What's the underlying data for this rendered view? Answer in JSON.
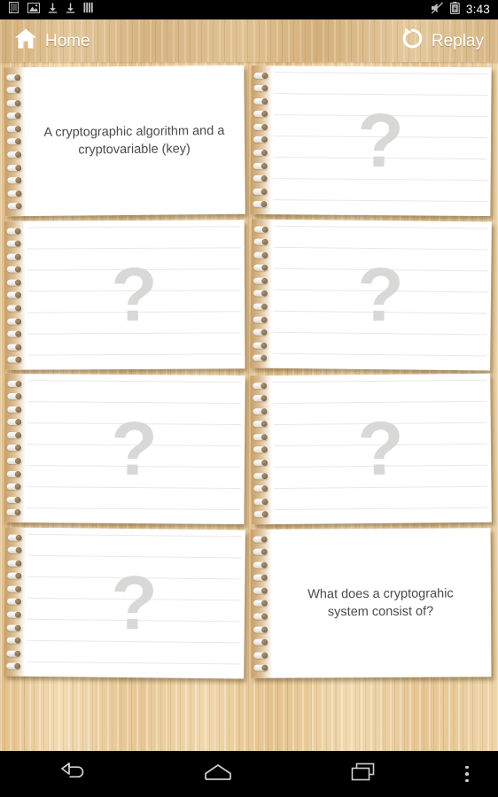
{
  "status_bar": {
    "icons": [
      "list-document-icon",
      "image-icon",
      "download-icon",
      "download-icon",
      "signal-bars-icon"
    ],
    "mute_icon": "volume-muted-icon",
    "battery_icon": "battery-charging-icon",
    "time": "3:43"
  },
  "header": {
    "home": {
      "icon": "home-icon",
      "label": "Home"
    },
    "replay": {
      "icon": "replay-icon",
      "label": "Replay"
    }
  },
  "board": {
    "columns": 2,
    "rows": 4,
    "face_down_symbol": "?",
    "cards": [
      {
        "position": 1,
        "state": "face-up",
        "text": "A cryptographic algorithm and a cryptovariable (key)"
      },
      {
        "position": 2,
        "state": "face-down",
        "text": "?"
      },
      {
        "position": 3,
        "state": "face-down",
        "text": "?"
      },
      {
        "position": 4,
        "state": "face-down",
        "text": "?"
      },
      {
        "position": 5,
        "state": "face-down",
        "text": "?"
      },
      {
        "position": 6,
        "state": "face-down",
        "text": "?"
      },
      {
        "position": 7,
        "state": "face-down",
        "text": "?"
      },
      {
        "position": 8,
        "state": "face-up",
        "text": "What does a cryptograhic system consist of?"
      }
    ]
  },
  "nav_bar": {
    "back": "back-icon",
    "home": "home-outline-icon",
    "recents": "recent-apps-icon",
    "overflow": "overflow-menu-icon"
  },
  "colors": {
    "wood": "#e9cb9c",
    "header_wood": "#d8b782",
    "card": "#ffffff",
    "question_mark": "#d9d8d7",
    "card_text": "#4a4a4a",
    "system_bar": "#000000"
  }
}
